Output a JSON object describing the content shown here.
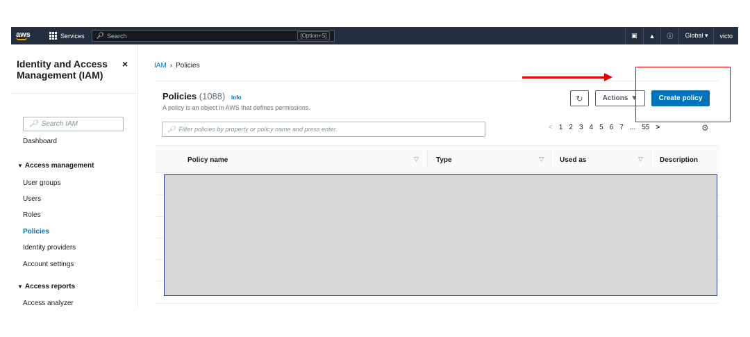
{
  "topbar": {
    "logo": "aws",
    "services_label": "Services",
    "search_placeholder": "Search",
    "search_shortcut": "[Option+S]",
    "region_label": "Global ▾",
    "user_label": "victo"
  },
  "sidebar": {
    "title": "Identity and Access Management (IAM)",
    "search_placeholder": "Search IAM",
    "dashboard": "Dashboard",
    "section_access_mgmt": "Access management",
    "items": [
      "User groups",
      "Users",
      "Roles",
      "Policies",
      "Identity providers",
      "Account settings"
    ],
    "section_access_reports": "Access reports",
    "reports_items": [
      "Access analyzer"
    ]
  },
  "breadcrumb": {
    "root": "IAM",
    "separator": "›",
    "current": "Policies"
  },
  "panel": {
    "title": "Policies",
    "count": "(1088)",
    "info": "Info",
    "description": "A policy is an object in AWS that defines permissions.",
    "actions_label": "Actions",
    "create_label": "Create policy",
    "filter_placeholder": "Filter policies by property or policy name and press enter.",
    "pagination": [
      "1",
      "2",
      "3",
      "4",
      "5",
      "6",
      "7",
      "...",
      "55"
    ]
  },
  "table": {
    "columns": [
      "Policy name",
      "Type",
      "Used as",
      "Description"
    ]
  },
  "colors": {
    "nav_bg": "#232f3e",
    "primary": "#0073bb",
    "annotation": "#e60000",
    "redaction": "#d7d7d7"
  },
  "icons": {
    "refresh": "refresh-icon",
    "settings": "gear-icon",
    "close": "close-icon",
    "search": "search-icon"
  }
}
